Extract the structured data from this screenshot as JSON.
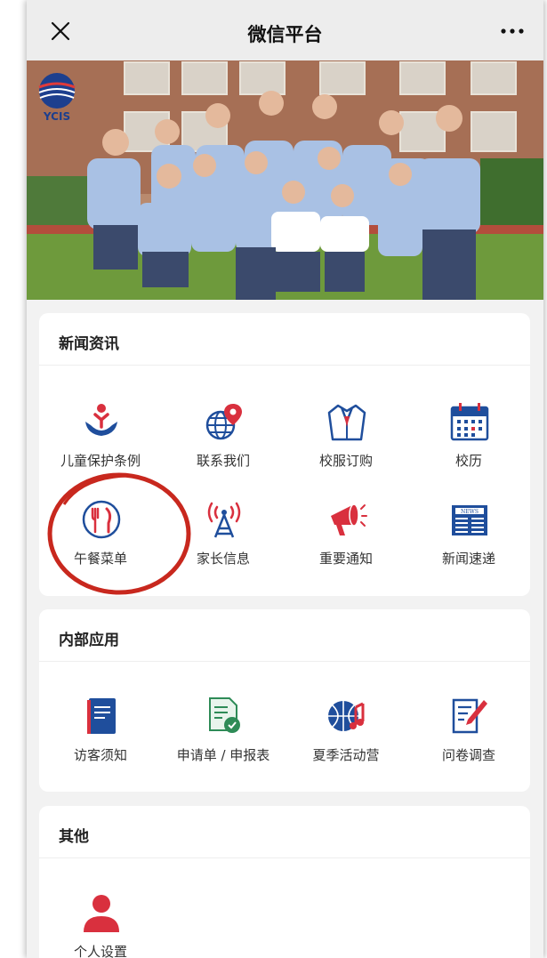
{
  "navbar": {
    "title": "微信平台",
    "close_icon": "close-icon",
    "more_icon": "more-icon"
  },
  "banner": {
    "logo_text": "YCIS"
  },
  "sections": {
    "news": {
      "title": "新闻资讯",
      "items": [
        {
          "label": "儿童保护条例",
          "icon": "child-protection-icon"
        },
        {
          "label": "联系我们",
          "icon": "globe-location-icon"
        },
        {
          "label": "校服订购",
          "icon": "uniform-icon"
        },
        {
          "label": "校历",
          "icon": "calendar-icon"
        },
        {
          "label": "午餐菜单",
          "icon": "fork-knife-icon"
        },
        {
          "label": "家长信息",
          "icon": "broadcast-tower-icon"
        },
        {
          "label": "重要通知",
          "icon": "megaphone-icon"
        },
        {
          "label": "新闻速递",
          "icon": "newspaper-icon"
        }
      ]
    },
    "internal": {
      "title": "内部应用",
      "items": [
        {
          "label": "访客须知",
          "icon": "book-icon"
        },
        {
          "label": "申请单 / 申报表",
          "icon": "form-document-icon"
        },
        {
          "label": "夏季活动营",
          "icon": "basketball-music-icon"
        },
        {
          "label": "问卷调查",
          "icon": "survey-pen-icon"
        }
      ]
    },
    "other": {
      "title": "其他",
      "items": [
        {
          "label": "个人设置",
          "icon": "user-icon"
        }
      ]
    }
  },
  "colors": {
    "primary_red": "#d9303e",
    "primary_blue": "#1f4e9c",
    "annotation_red": "#c8281e"
  }
}
